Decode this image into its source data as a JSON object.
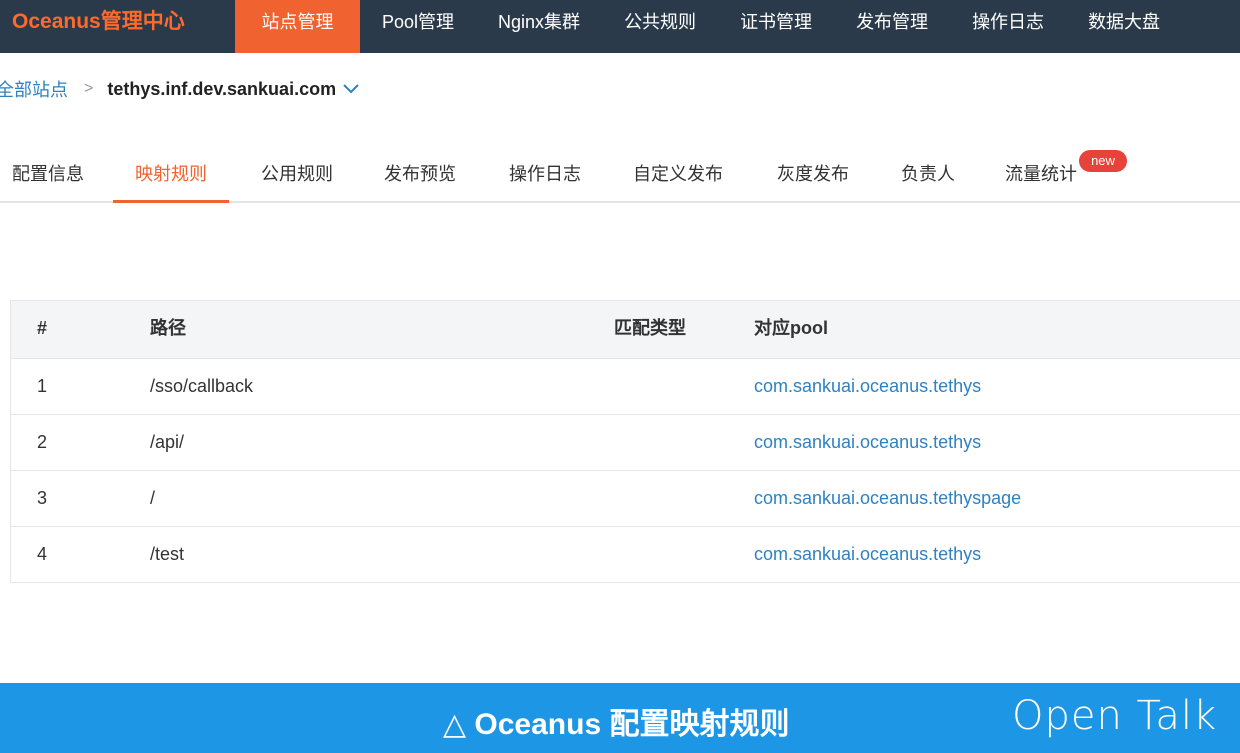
{
  "topnav": {
    "brand": "Oceanus管理中心",
    "items": [
      "站点管理",
      "Pool管理",
      "Nginx集群",
      "公共规则",
      "证书管理",
      "发布管理",
      "操作日志",
      "数据大盘"
    ]
  },
  "breadcrumb": {
    "root": "全部站点",
    "separator": ">",
    "current": "tethys.inf.dev.sankuai.com"
  },
  "tabs": {
    "items": [
      "配置信息",
      "映射规则",
      "公用规则",
      "发布预览",
      "操作日志",
      "自定义发布",
      "灰度发布",
      "负责人",
      "流量统计"
    ],
    "new_badge": "new"
  },
  "table": {
    "headers": [
      "#",
      "路径",
      "匹配类型",
      "对应pool"
    ],
    "rows": [
      {
        "idx": "1",
        "path": "/sso/callback",
        "match_type": "",
        "pool": "com.sankuai.oceanus.tethys"
      },
      {
        "idx": "2",
        "path": "/api/",
        "match_type": "",
        "pool": "com.sankuai.oceanus.tethys"
      },
      {
        "idx": "3",
        "path": "/",
        "match_type": "",
        "pool": "com.sankuai.oceanus.tethyspage"
      },
      {
        "idx": "4",
        "path": "/test",
        "match_type": "",
        "pool": "com.sankuai.oceanus.tethys"
      }
    ]
  },
  "banner": {
    "caption": "△ Oceanus 配置映射规则",
    "logo": "Open Talk"
  },
  "colors": {
    "nav_bg": "#2b3a4a",
    "accent": "#f0622f",
    "link": "#2d82c4",
    "banner_bg": "#1e96e6",
    "badge": "#e8433a"
  }
}
